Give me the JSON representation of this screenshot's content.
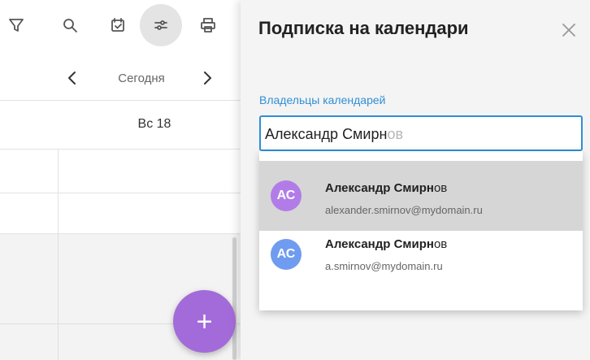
{
  "toolbar": {
    "icons": [
      "filter-icon",
      "search-icon",
      "calendar-check-icon",
      "sliders-icon",
      "printer-icon"
    ]
  },
  "nav": {
    "today_label": "Сегодня"
  },
  "day_header": {
    "label": "Вс 18"
  },
  "fab": {
    "label": "+",
    "color": "#a36bd9"
  },
  "panel": {
    "title": "Подписка на календари",
    "field_label": "Владельцы календарей",
    "input_typed": "Александр Смирн",
    "input_hint": "ов",
    "accent": "#2f8fd6"
  },
  "suggestions": [
    {
      "initials": "АС",
      "name_match": "Александр Смирн",
      "name_rest": "ов",
      "email": "alexander.smirnov@mydomain.ru",
      "avatar_color": "#b27ce8",
      "selected": true
    },
    {
      "initials": "АС",
      "name_match": "Александр Смирн",
      "name_rest": "ов",
      "email": "a.smirnov@mydomain.ru",
      "avatar_color": "#6f9cf0",
      "selected": false
    }
  ]
}
